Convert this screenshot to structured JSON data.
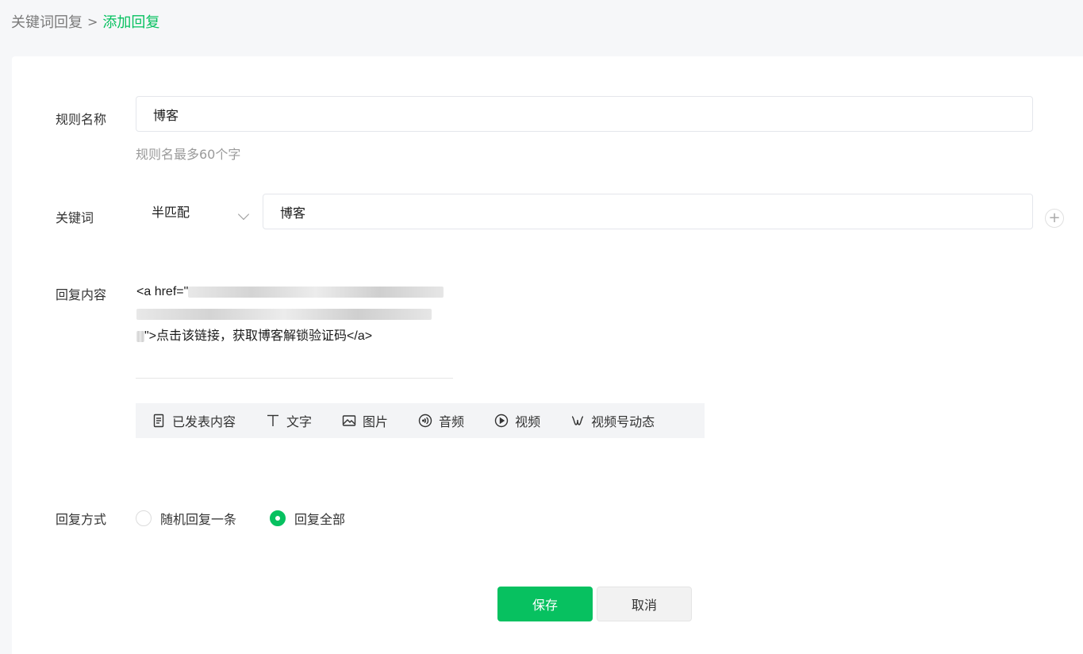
{
  "breadcrumb": {
    "parent": "关键词回复",
    "separator": ">",
    "current": "添加回复"
  },
  "form": {
    "rule_name": {
      "label": "规则名称",
      "value": "博客",
      "hint": "规则名最多60个字"
    },
    "keyword": {
      "label": "关键词",
      "match_mode": "半匹配",
      "value": "博客",
      "add_icon": "plus-circle-icon"
    },
    "reply_content": {
      "label": "回复内容",
      "line1_prefix": "<a href=\"",
      "line3_text": "\">点击该链接，获取博客解锁验证码</a>"
    },
    "toolbar": [
      {
        "name": "published",
        "label": "已发表内容",
        "icon": "document-icon"
      },
      {
        "name": "text",
        "label": "文字",
        "icon": "text-icon"
      },
      {
        "name": "image",
        "label": "图片",
        "icon": "image-icon"
      },
      {
        "name": "audio",
        "label": "音频",
        "icon": "audio-icon"
      },
      {
        "name": "video",
        "label": "视频",
        "icon": "video-icon"
      },
      {
        "name": "channels",
        "label": "视频号动态",
        "icon": "channels-icon"
      }
    ],
    "reply_mode": {
      "label": "回复方式",
      "options": [
        {
          "label": "随机回复一条",
          "checked": false
        },
        {
          "label": "回复全部",
          "checked": true
        }
      ]
    }
  },
  "actions": {
    "save": "保存",
    "cancel": "取消"
  },
  "colors": {
    "accent": "#07c160",
    "page_bg": "#f6f7f9",
    "card_bg": "#ffffff"
  }
}
